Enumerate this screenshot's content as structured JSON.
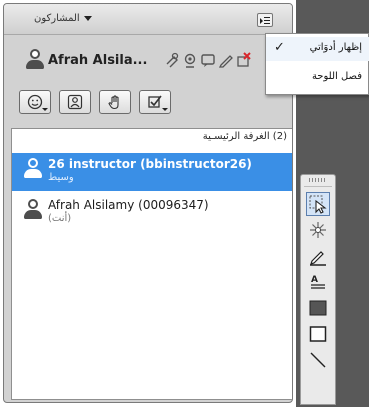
{
  "panel": {
    "title": "المشاركون"
  },
  "current_user": {
    "name": "Afrah Alsila..."
  },
  "participants": {
    "room_label": "(2) الغرفة الرئيسـية",
    "rows": [
      {
        "name": "26 instructor (bbinstructor26)",
        "role": "وسيط",
        "selected": true
      },
      {
        "name": "Afrah Alsilamy (00096347)",
        "role": "(أنت)",
        "selected": false
      }
    ]
  },
  "popup_menu": {
    "items": [
      {
        "check": "✓",
        "label": "إظهار أدوَاتي"
      },
      {
        "check": "",
        "label": "فصل اللوحة"
      }
    ]
  },
  "colors": {
    "selection": "#3a8fe6",
    "dark_column": "#595959",
    "erase_accent": "#d9262b"
  }
}
